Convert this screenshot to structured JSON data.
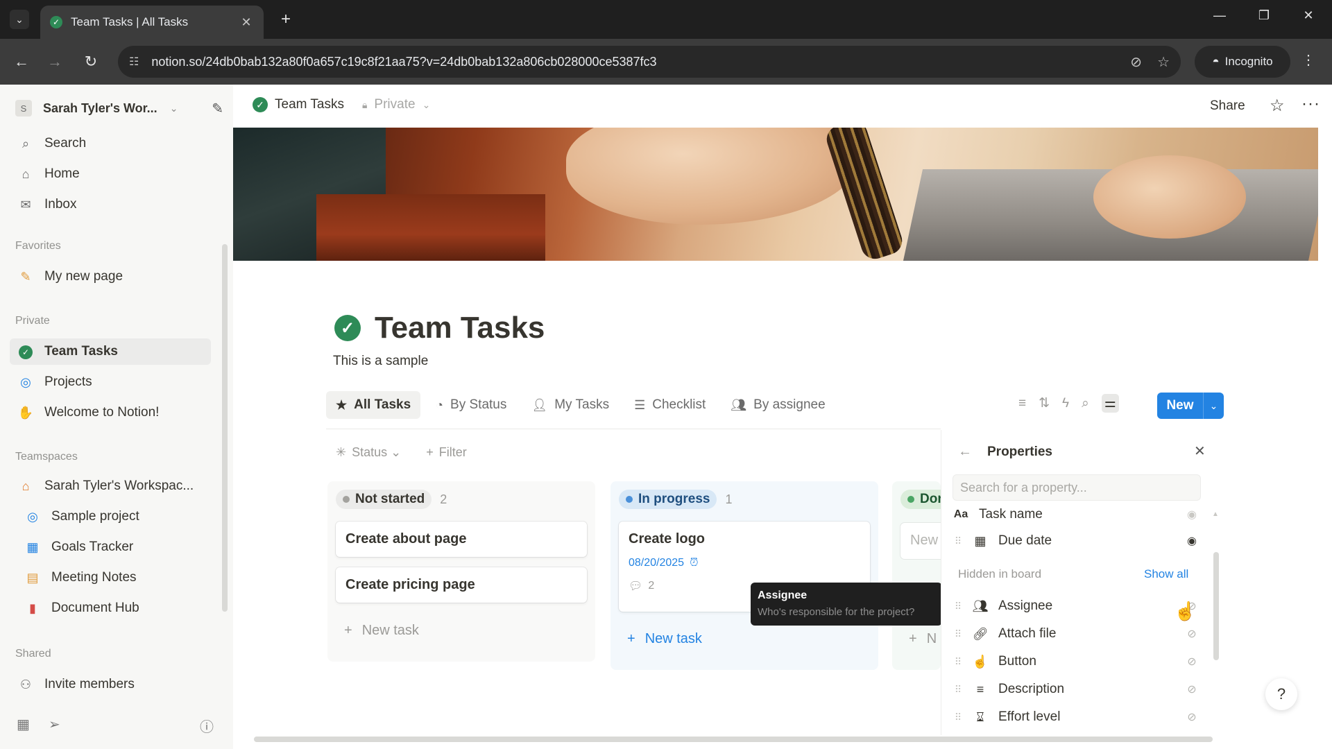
{
  "browser": {
    "tab_title": "Team Tasks | All Tasks",
    "url": "notion.so/24db0bab132a80f0a657c19c8f21aa75?v=24db0bab132a806cb028000ce5387fc3",
    "incognito_label": "Incognito"
  },
  "sidebar": {
    "workspace_initial": "S",
    "workspace_name": "Sarah Tyler's Wor...",
    "nav": [
      {
        "label": "Search",
        "icon": "search-icon"
      },
      {
        "label": "Home",
        "icon": "home-icon"
      },
      {
        "label": "Inbox",
        "icon": "inbox-icon"
      }
    ],
    "favorites_label": "Favorites",
    "favorites": [
      {
        "label": "My new page",
        "icon": "pencil-icon"
      }
    ],
    "private_label": "Private",
    "private": [
      {
        "label": "Team Tasks",
        "icon": "check-circle-icon"
      },
      {
        "label": "Projects",
        "icon": "target-icon"
      },
      {
        "label": "Welcome to Notion!",
        "icon": "wave-icon"
      }
    ],
    "teamspaces_label": "Teamspaces",
    "teamspaces": [
      {
        "label": "Sarah Tyler's Workspac...",
        "icon": "house-icon"
      },
      {
        "label": "Sample project",
        "icon": "target-icon"
      },
      {
        "label": "Goals Tracker",
        "icon": "chart-icon"
      },
      {
        "label": "Meeting Notes",
        "icon": "calendar-icon"
      },
      {
        "label": "Document Hub",
        "icon": "document-icon"
      }
    ],
    "shared_label": "Shared",
    "invite_label": "Invite members"
  },
  "topbar": {
    "breadcrumb_title": "Team Tasks",
    "privacy_label": "Private",
    "share_label": "Share"
  },
  "page": {
    "title": "Team Tasks",
    "description": "This is a sample"
  },
  "views": [
    {
      "label": "All Tasks",
      "icon": "star-icon",
      "active": true
    },
    {
      "label": "By Status",
      "icon": "status-icon",
      "active": false
    },
    {
      "label": "My Tasks",
      "icon": "person-icon",
      "active": false
    },
    {
      "label": "Checklist",
      "icon": "checklist-icon",
      "active": false
    },
    {
      "label": "By assignee",
      "icon": "people-icon",
      "active": false
    }
  ],
  "toolbar": {
    "new_label": "New"
  },
  "filters": {
    "status_label": "Status",
    "filter_label": "Filter"
  },
  "board": {
    "columns": [
      {
        "status": "Not started",
        "count": "2",
        "cards": [
          {
            "title": "Create about page"
          },
          {
            "title": "Create pricing page"
          }
        ],
        "new_task_label": "New task"
      },
      {
        "status": "In progress",
        "count": "1",
        "cards": [
          {
            "title": "Create logo",
            "date": "08/20/2025",
            "comments": "2"
          }
        ],
        "new_task_label": "New task"
      },
      {
        "status": "Dor",
        "ghost_card": "New",
        "new_task_label": "N"
      }
    ]
  },
  "tooltip": {
    "title": "Assignee",
    "subtitle": "Who's responsible for the project?"
  },
  "properties_panel": {
    "title": "Properties",
    "search_placeholder": "Search for a property...",
    "visible": [
      {
        "label": "Task name",
        "icon": "text-type-icon"
      },
      {
        "label": "Due date",
        "icon": "calendar-icon"
      }
    ],
    "hidden_label": "Hidden in board",
    "show_all_label": "Show all",
    "hidden": [
      {
        "label": "Assignee",
        "icon": "people-icon"
      },
      {
        "label": "Attach file",
        "icon": "paperclip-icon"
      },
      {
        "label": "Button",
        "icon": "button-icon"
      },
      {
        "label": "Description",
        "icon": "lines-icon"
      },
      {
        "label": "Effort level",
        "icon": "hourglass-icon"
      }
    ]
  },
  "colors": {
    "accent": "#2383e2",
    "check_green": "#2e8b57",
    "in_progress_blue": "#4a90d9",
    "done_green": "#4aa564"
  }
}
